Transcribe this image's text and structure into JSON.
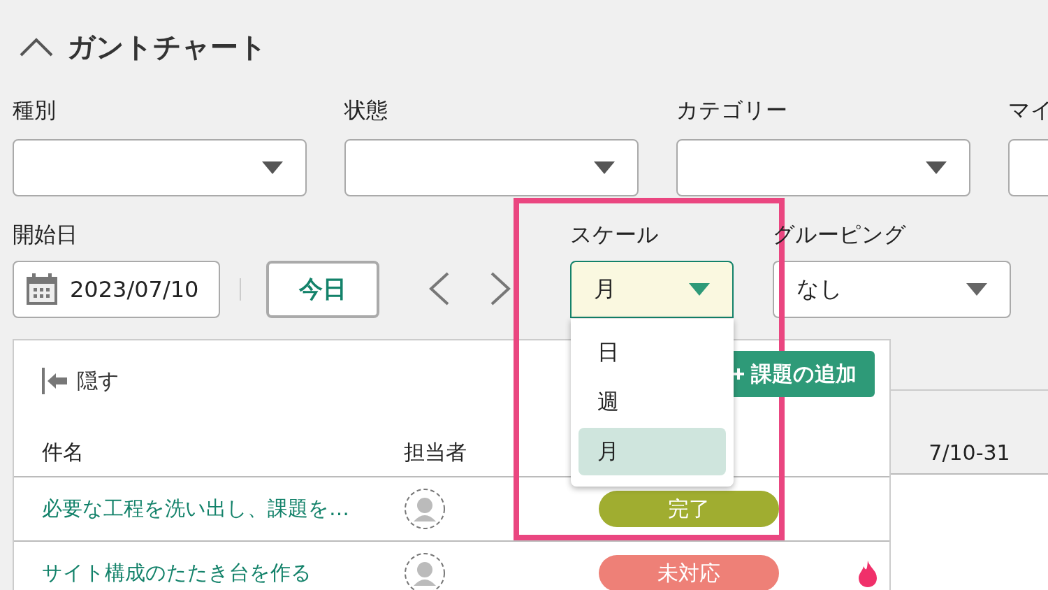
{
  "section": {
    "title": "ガントチャート",
    "expanded": true
  },
  "filters": [
    {
      "label": "種別"
    },
    {
      "label": "状態"
    },
    {
      "label": "カテゴリー"
    },
    {
      "label": "マイ"
    }
  ],
  "start_date": {
    "label": "開始日",
    "value": "2023/07/10"
  },
  "today_button": "今日",
  "scale": {
    "label": "スケール",
    "value": "月",
    "open": true,
    "options": [
      {
        "label": "日",
        "selected": false
      },
      {
        "label": "週",
        "selected": false
      },
      {
        "label": "月",
        "selected": true
      }
    ]
  },
  "grouping": {
    "label": "グルーピング",
    "value": "なし"
  },
  "hide_button": "隠す",
  "add_button": "課題の追加",
  "table": {
    "columns": [
      "件名",
      "担当者"
    ],
    "rows": [
      {
        "title": "必要な工程を洗い出し、課題を…",
        "status": "完了",
        "color": "#a0ad30",
        "hot": false
      },
      {
        "title": "サイト構成のたたき台を作る",
        "status": "未対応",
        "color": "#ee8077",
        "hot": true
      }
    ]
  },
  "timeline": {
    "period": "7/10-31"
  },
  "highlight_frame": true
}
